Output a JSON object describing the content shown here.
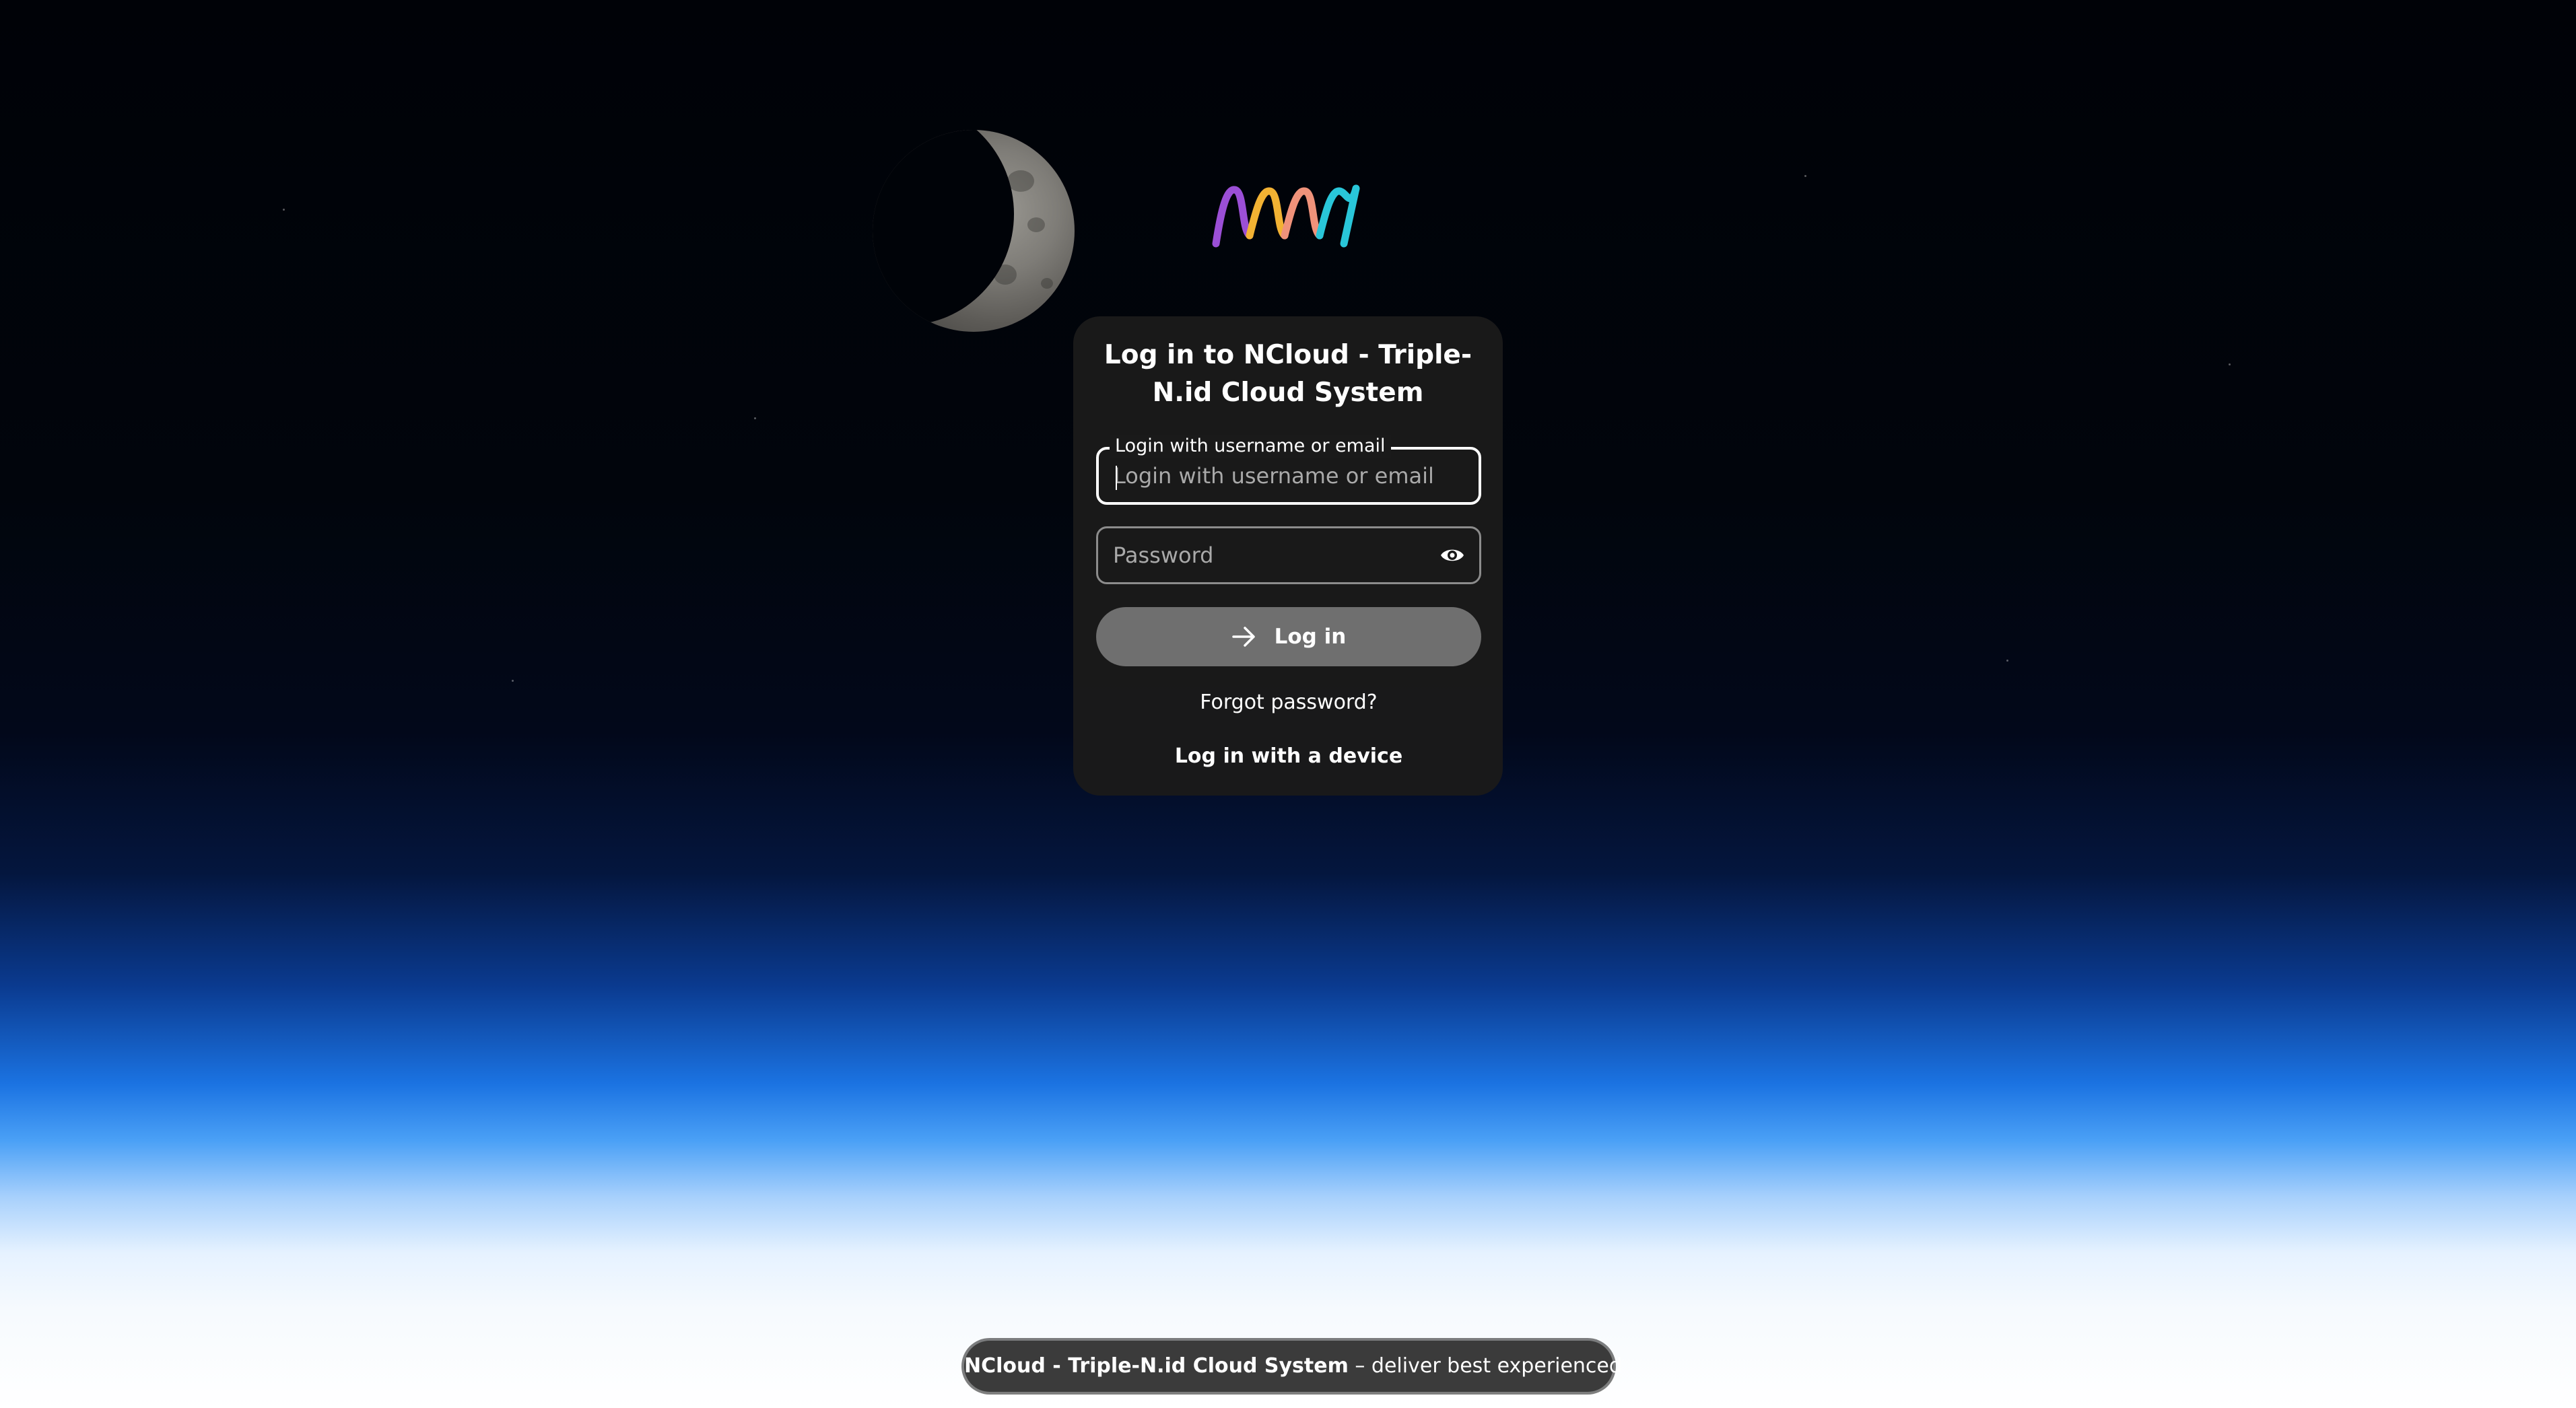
{
  "logo": {
    "icon": "ncloud-wave-logo",
    "colors": [
      "#9b4fd6",
      "#f2b233",
      "#f0927a",
      "#29c6d9"
    ]
  },
  "login": {
    "title": "Log in to NCloud - Triple-N.id Cloud System",
    "username_legend": "Login with username or email",
    "username_placeholder": "Login with username or email",
    "password_placeholder": "Password",
    "login_button": "Log in",
    "forgot_password": "Forgot password?",
    "device_login": "Log in with a device"
  },
  "footer": {
    "brand": "NCloud - Triple-N.id Cloud System",
    "tagline": " – deliver best experienced"
  },
  "colors": {
    "card_bg": "#1a1a1a",
    "button_bg": "#6f6f6f",
    "footer_bg": "#3b3b3b"
  }
}
